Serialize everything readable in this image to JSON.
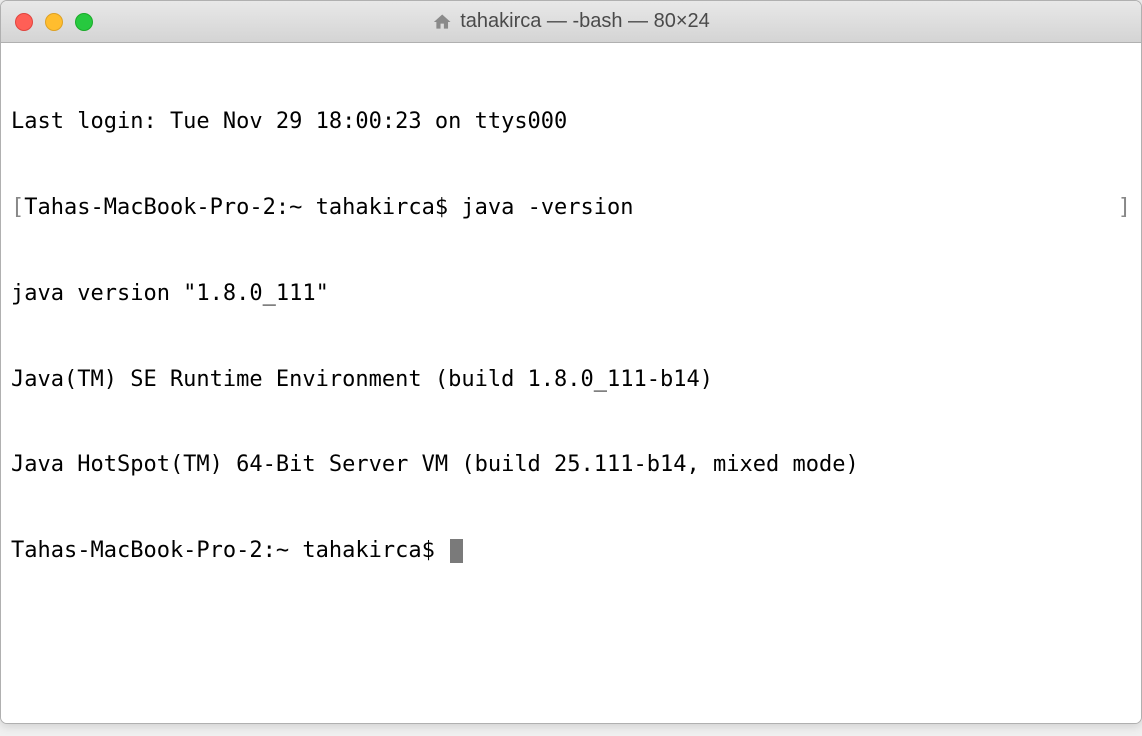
{
  "window": {
    "title": "tahakirca — -bash — 80×24"
  },
  "terminal": {
    "line1": "Last login: Tue Nov 29 18:00:23 on ttys000",
    "line2_bracket_open": "[",
    "line2_prompt": "Tahas-MacBook-Pro-2:~ tahakirca$ ",
    "line2_command": "java -version",
    "line2_bracket_close": "]",
    "line3": "java version \"1.8.0_111\"",
    "line4": "Java(TM) SE Runtime Environment (build 1.8.0_111-b14)",
    "line5": "Java HotSpot(TM) 64-Bit Server VM (build 25.111-b14, mixed mode)",
    "line6_prompt": "Tahas-MacBook-Pro-2:~ tahakirca$ "
  }
}
